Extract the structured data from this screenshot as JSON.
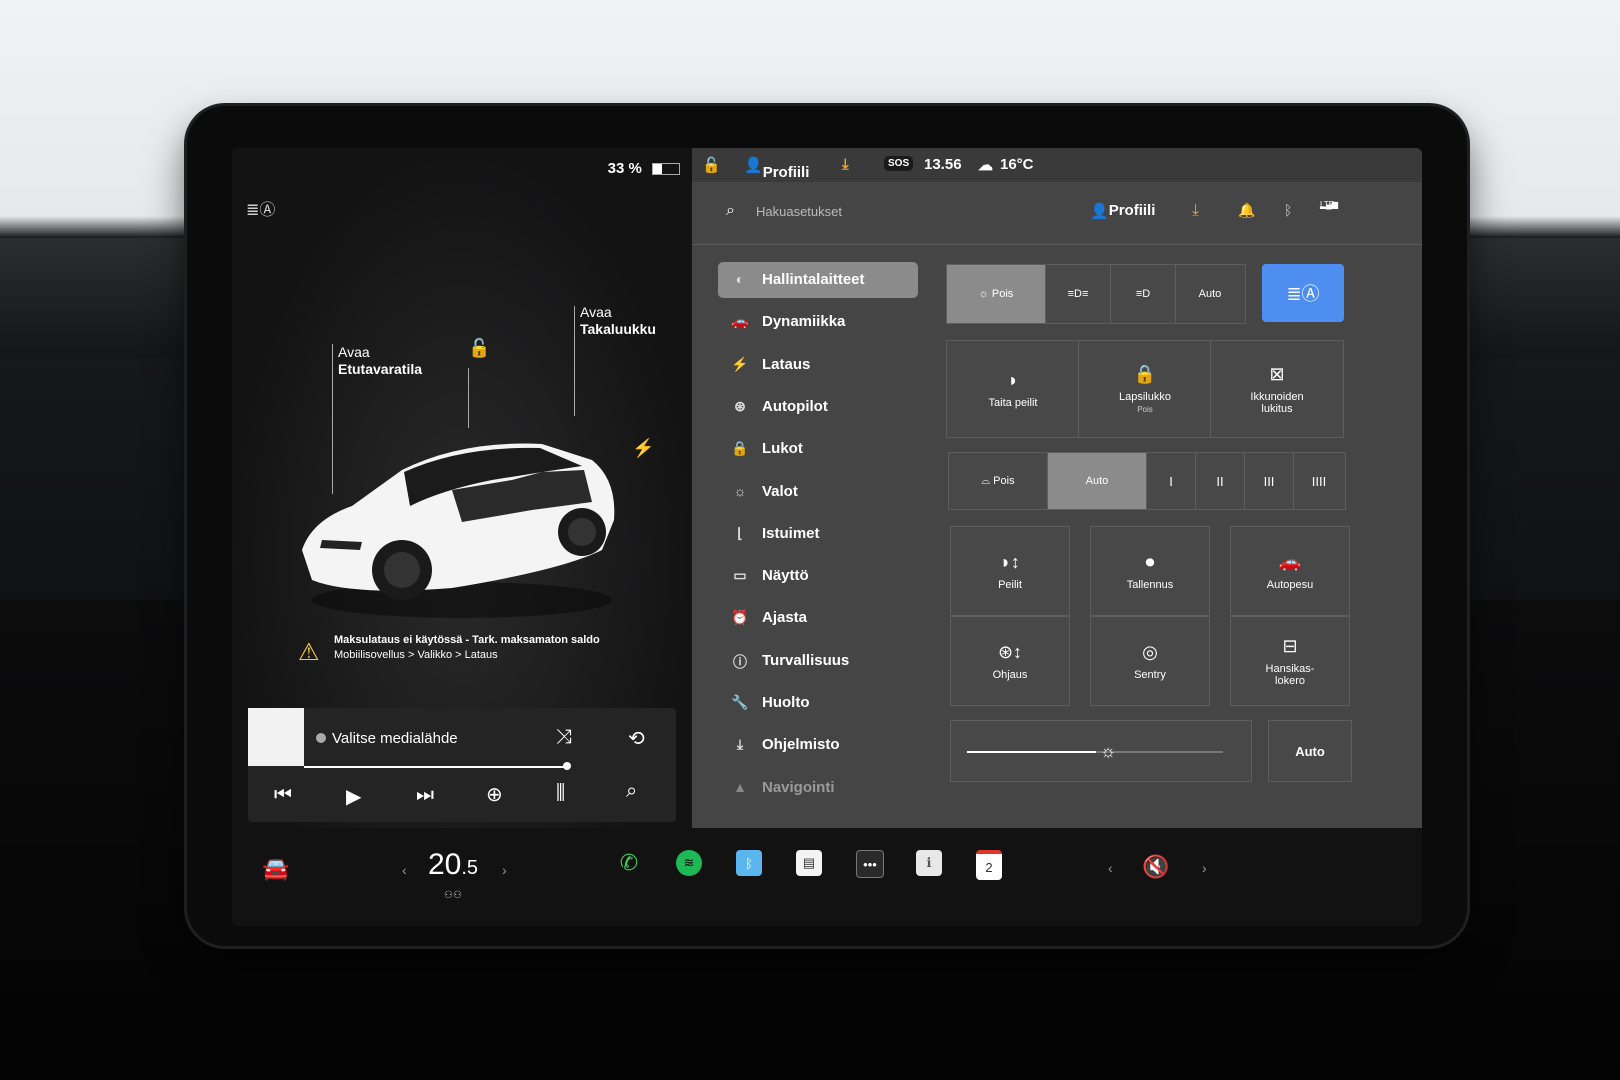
{
  "car_pane": {
    "battery_percent": "33 %",
    "battery_level": 0.33,
    "labels": {
      "frunk_line1": "Avaa",
      "frunk_line2": "Etutavaratila",
      "trunk_line1": "Avaa",
      "trunk_line2": "Takaluukku"
    },
    "warning_title": "Maksulataus ei käytössä - Tark. maksamaton saldo",
    "warning_path": "Mobiilisovellus > Valikko > Lataus"
  },
  "media": {
    "title": "Valitse medialähde",
    "progress": 0.96
  },
  "statusbar": {
    "profile": "Profiili",
    "sos": "SOS",
    "time": "13.56",
    "temperature": "16°C"
  },
  "settings": {
    "search_placeholder": "Hakuasetukset",
    "profile": "Profiili",
    "lte": "LTE",
    "menu": [
      {
        "label": "Hallintalaitteet",
        "icon": "toggle-icon"
      },
      {
        "label": "Dynamiikka",
        "icon": "car-icon"
      },
      {
        "label": "Lataus",
        "icon": "bolt-icon"
      },
      {
        "label": "Autopilot",
        "icon": "steering-wheel-icon"
      },
      {
        "label": "Lukot",
        "icon": "lock-icon"
      },
      {
        "label": "Valot",
        "icon": "light-icon"
      },
      {
        "label": "Istuimet",
        "icon": "seat-icon"
      },
      {
        "label": "Näyttö",
        "icon": "display-icon"
      },
      {
        "label": "Ajasta",
        "icon": "alarm-icon"
      },
      {
        "label": "Turvallisuus",
        "icon": "info-icon"
      },
      {
        "label": "Huolto",
        "icon": "wrench-icon"
      },
      {
        "label": "Ohjelmisto",
        "icon": "download-icon"
      },
      {
        "label": "Navigointi",
        "icon": "navigation-icon"
      }
    ],
    "lights": {
      "off": "Pois",
      "auto": "Auto"
    },
    "mirrors": {
      "fold": "Taita peilit",
      "child_lock": "Lapsilukko",
      "child_lock_state": "Pois",
      "window_lock_1": "Ikkunoiden",
      "window_lock_2": "lukitus"
    },
    "wipers": {
      "off": "Pois",
      "auto": "Auto",
      "speeds": [
        "I",
        "II",
        "III",
        "IIII"
      ]
    },
    "tiles": {
      "mirrors": "Peilit",
      "record": "Tallennus",
      "carwash": "Autopesu",
      "steering": "Ohjaus",
      "sentry": "Sentry",
      "glovebox_1": "Hansikas-",
      "glovebox_2": "lokero"
    },
    "brightness_auto": "Auto",
    "brightness_level": 0.55
  },
  "bottombar": {
    "temperature_main": "20",
    "temperature_decimal": ".5",
    "calendar_day": "2"
  },
  "colors": {
    "accent_blue": "#4d8ef0",
    "warning_yellow": "#f2c94c",
    "download_orange": "#f5a623",
    "phone_green": "#3ecf5e",
    "spotify_green": "#1db954"
  }
}
